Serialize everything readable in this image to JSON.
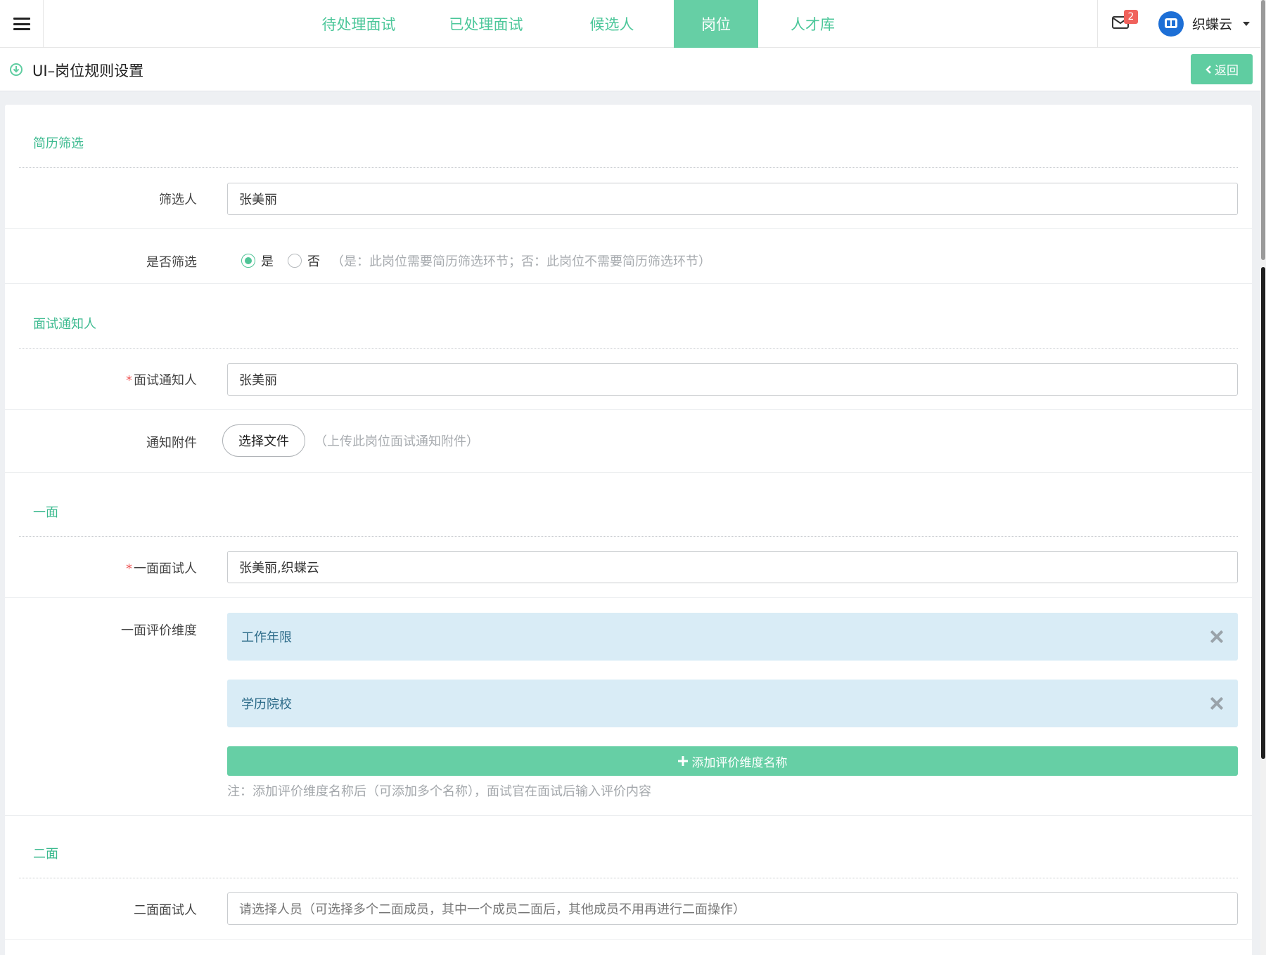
{
  "nav": {
    "tabs": [
      {
        "label": "待处理面试",
        "active": false
      },
      {
        "label": "已处理面试",
        "active": false
      },
      {
        "label": "候选人",
        "active": false
      },
      {
        "label": "岗位",
        "active": true
      },
      {
        "label": "人才库",
        "active": false
      }
    ]
  },
  "user": {
    "mail_count": "2",
    "name": "织蝶云"
  },
  "page": {
    "title": "UI–岗位规则设置",
    "back_label": "返回"
  },
  "sections": {
    "screening": {
      "title": "简历筛选",
      "screener_label": "筛选人",
      "screener_value": "张美丽",
      "toggle_label": "是否筛选",
      "yes_label": "是",
      "no_label": "否",
      "toggle_hint": "（是：此岗位需要简历筛选环节；否：此岗位不需要简历筛选环节）",
      "toggle_value": "yes"
    },
    "notify": {
      "title": "面试通知人",
      "notifier_label": "面试通知人",
      "notifier_value": "张美丽",
      "attachment_label": "通知附件",
      "attachment_button": "选择文件",
      "attachment_hint": "（上传此岗位面试通知附件）"
    },
    "round1": {
      "title": "一面",
      "interviewer_label": "一面面试人",
      "interviewer_value": "张美丽,织蝶云",
      "dimension_label": "一面评价维度",
      "dimensions": [
        "工作年限",
        "学历院校"
      ],
      "add_button": "添加评价维度名称",
      "note": "注：添加评价维度名称后（可添加多个名称），面试官在面试后输入评价内容"
    },
    "round2": {
      "title": "二面",
      "interviewer_label": "二面面试人",
      "interviewer_placeholder": "请选择人员（可选择多个二面成员，其中一个成员二面后，其他成员不用再进行二面操作）"
    }
  },
  "colors": {
    "accent": "#66cfa5",
    "accent_text": "#3cba8f",
    "required": "#e55555",
    "dimension_bg": "#d9ecf6"
  }
}
